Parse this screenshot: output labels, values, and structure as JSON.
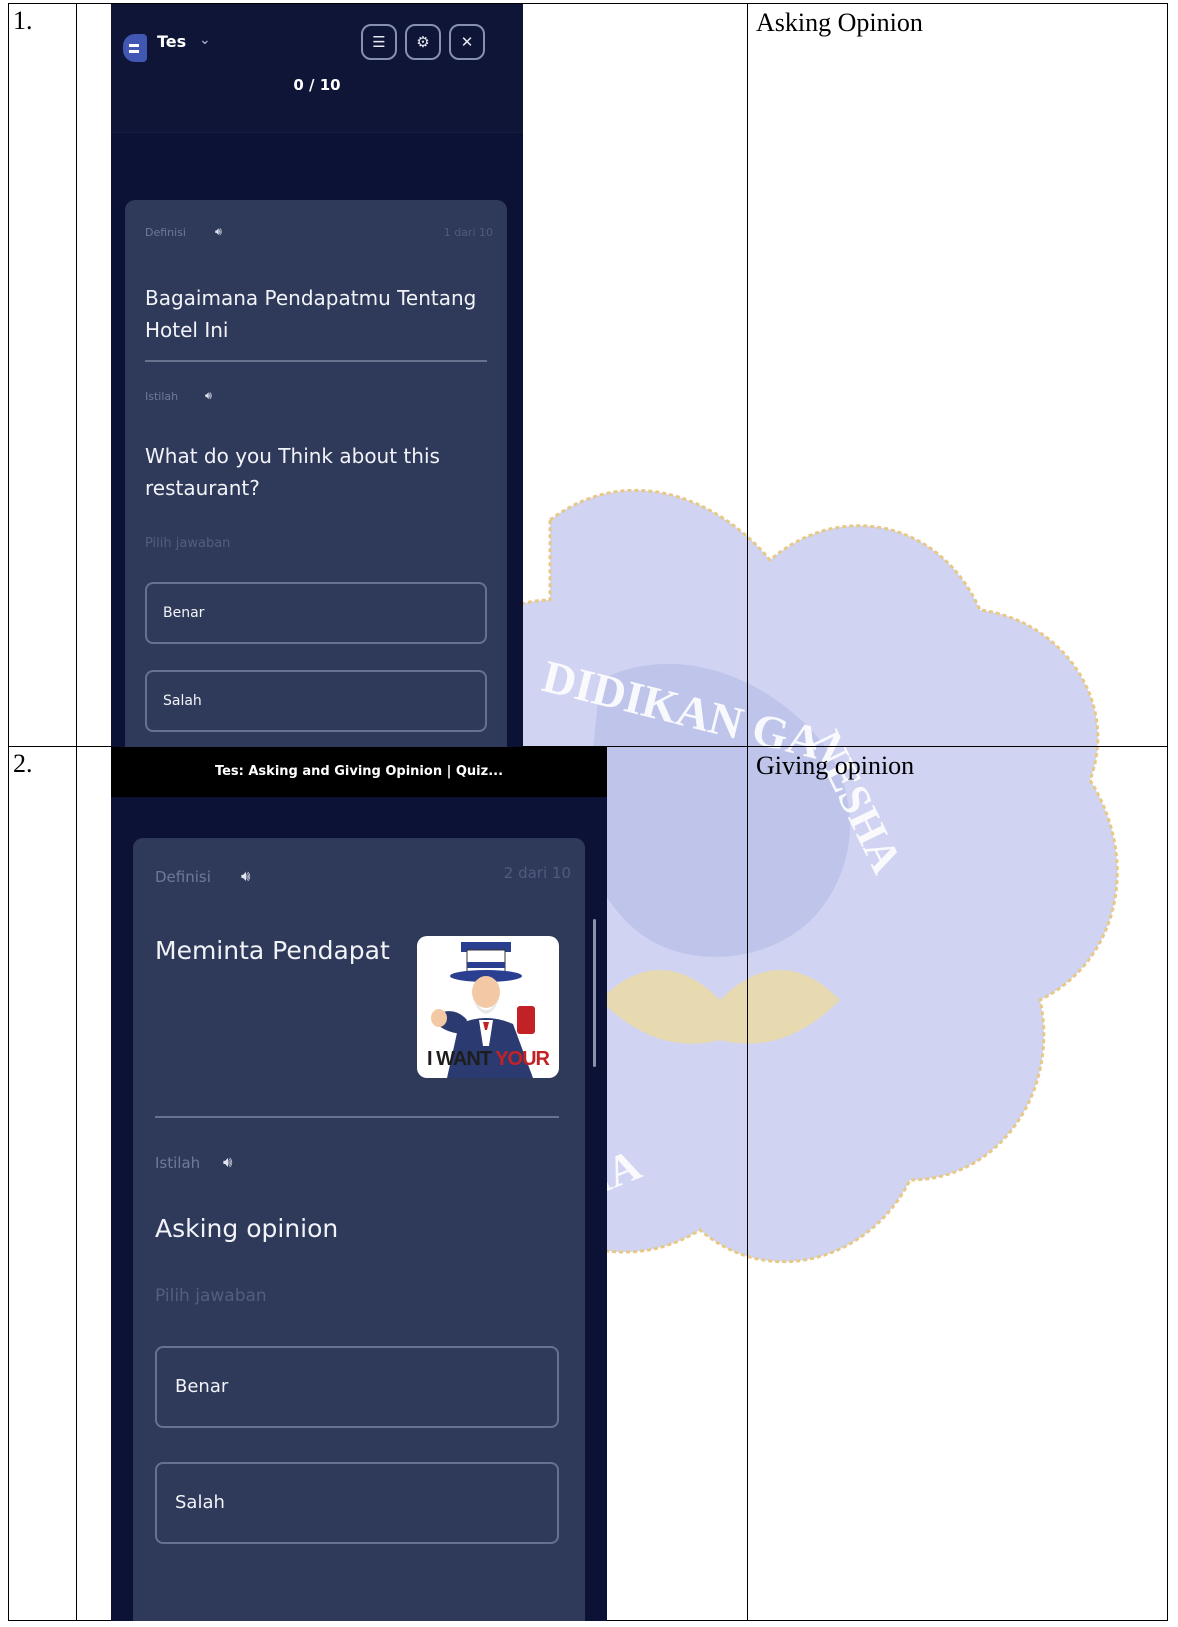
{
  "rows": [
    {
      "number": "1.",
      "description": "Asking Opinion",
      "screen": {
        "set_name": "Tes",
        "progress": "0 / 10",
        "card": {
          "definition_label": "Definisi",
          "counter": "1 dari 10",
          "definition_text": "Bagaimana Pendapatmu Tentang Hotel Ini",
          "term_label": "Istilah",
          "term_text": "What do you Think about this restaurant?",
          "prompt": "Pilih jawaban",
          "options": [
            "Benar",
            "Salah"
          ]
        }
      }
    },
    {
      "number": "2.",
      "description": "Giving opinion",
      "screen": {
        "window_title": "Tes: Asking and Giving Opinion | Quiz...",
        "card": {
          "definition_label": "Definisi",
          "counter": "2 dari 10",
          "definition_text": "Meminta Pendapat",
          "image_caption": "I WANT YOUR OPINION",
          "term_label": "Istilah",
          "term_text": "Asking opinion",
          "prompt": "Pilih jawaban",
          "options": [
            "Benar",
            "Salah"
          ]
        }
      }
    }
  ],
  "watermark_text": "PENDIDIKAN GANESHA",
  "colors": {
    "app_background": "#0c1236",
    "card": "#2f3a5a",
    "watermark": "#c8cdf0"
  }
}
